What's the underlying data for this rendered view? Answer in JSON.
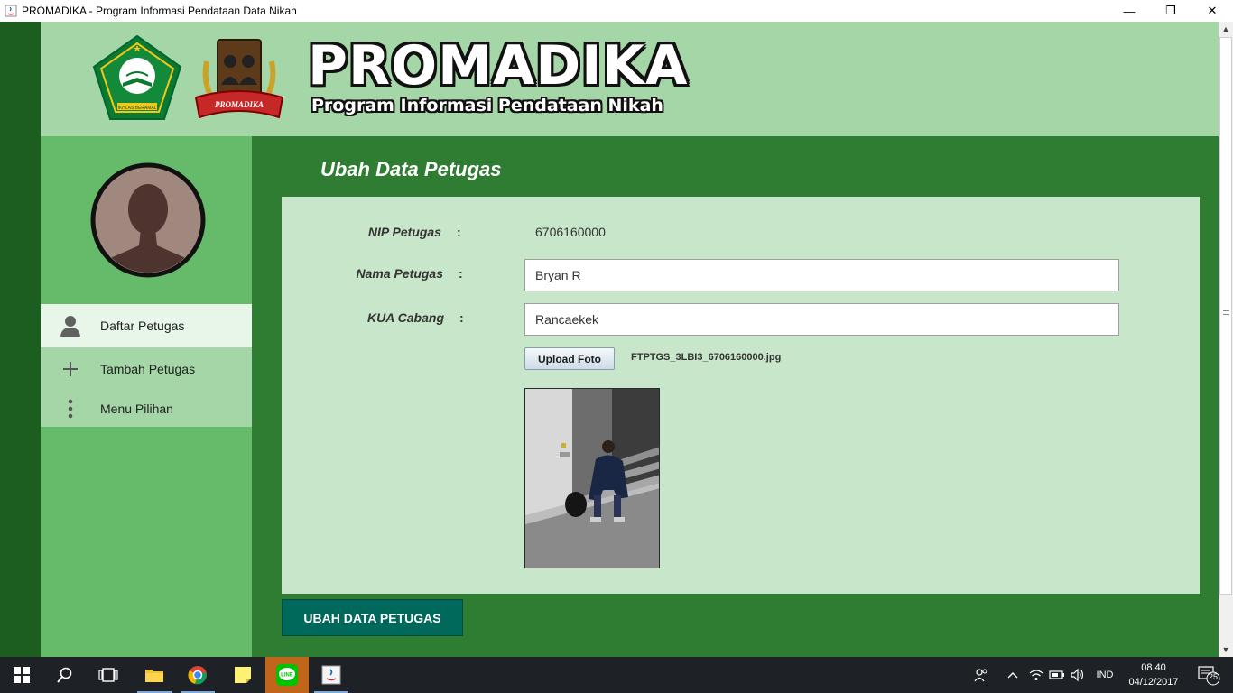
{
  "window": {
    "title": "PROMADIKA - Program Informasi Pendataan Data Nikah",
    "minimize": "—",
    "maximize": "❐",
    "close": "✕"
  },
  "header": {
    "brand": "PROMADIKA",
    "subtitle": "Program Informasi Pendataan Nikah",
    "logo_left_text": "IKHLAS BERAMAL",
    "logo_right_text": "PROMADIKA"
  },
  "sidebar": {
    "items": [
      {
        "label": "Daftar Petugas",
        "icon": "person-icon",
        "active": true
      },
      {
        "label": "Tambah Petugas",
        "icon": "plus-icon",
        "active": false
      },
      {
        "label": "Menu Pilihan",
        "icon": "more-vertical-icon",
        "active": false
      }
    ]
  },
  "main": {
    "title": "Ubah Data Petugas",
    "form": {
      "nip_label": "NIP Petugas",
      "nip_value": "6706160000",
      "nama_label": "Nama Petugas",
      "nama_value": "Bryan R",
      "kua_label": "KUA Cabang",
      "kua_value": "Rancaekek",
      "colon": ":",
      "upload_label": "Upload Foto",
      "filename": "FTPTGS_3LBI3_6706160000.jpg"
    },
    "submit_label": "UBAH DATA PETUGAS"
  },
  "taskbar": {
    "language": "IND",
    "time": "08.40",
    "date": "04/12/2017",
    "notification_count": "25",
    "line_label": "LINE"
  },
  "colors": {
    "header_bg": "#a5d6a7",
    "app_bg": "#2e7d32",
    "sidebar_bg": "#66bb6a",
    "panel_bg": "#c8e6c9",
    "submit_bg": "#00695c"
  }
}
